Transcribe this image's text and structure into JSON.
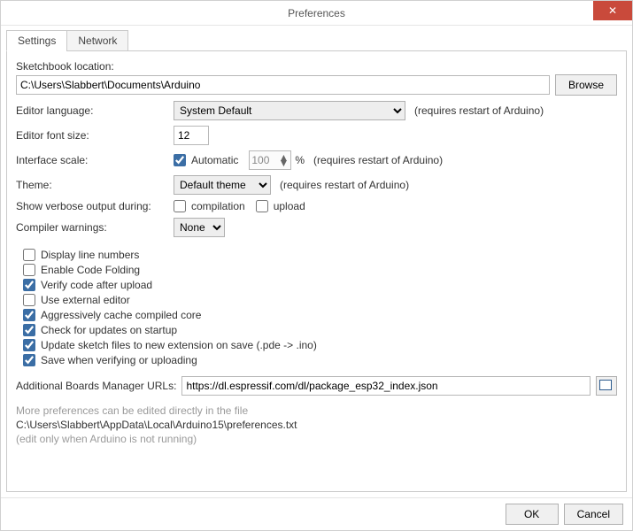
{
  "window": {
    "title": "Preferences"
  },
  "tabs": [
    "Settings",
    "Network"
  ],
  "labels": {
    "sketchbook": "Sketchbook location:",
    "browse": "Browse",
    "language": "Editor language:",
    "fontsize": "Editor font size:",
    "scale": "Interface scale:",
    "automatic": "Automatic",
    "percent": "%",
    "theme": "Theme:",
    "verbose": "Show verbose output during:",
    "compilation": "compilation",
    "upload": "upload",
    "warnings": "Compiler warnings:",
    "boards": "Additional Boards Manager URLs:",
    "restart": "(requires restart of Arduino)",
    "ok": "OK",
    "cancel": "Cancel"
  },
  "values": {
    "sketchbook": "C:\\Users\\Slabbert\\Documents\\Arduino",
    "language": "System Default",
    "fontsize": "12",
    "scale": "100",
    "theme": "Default theme",
    "warnings": "None",
    "boards_url": "https://dl.espressif.com/dl/package_esp32_index.json"
  },
  "checks": [
    {
      "label": "Display line numbers",
      "checked": false
    },
    {
      "label": "Enable Code Folding",
      "checked": false
    },
    {
      "label": "Verify code after upload",
      "checked": true
    },
    {
      "label": "Use external editor",
      "checked": false
    },
    {
      "label": "Aggressively cache compiled core",
      "checked": true
    },
    {
      "label": "Check for updates on startup",
      "checked": true
    },
    {
      "label": "Update sketch files to new extension on save (.pde -> .ino)",
      "checked": true
    },
    {
      "label": "Save when verifying or uploading",
      "checked": true
    }
  ],
  "footer": {
    "more": "More preferences can be edited directly in the file",
    "path": "C:\\Users\\Slabbert\\AppData\\Local\\Arduino15\\preferences.txt",
    "note": "(edit only when Arduino is not running)"
  }
}
